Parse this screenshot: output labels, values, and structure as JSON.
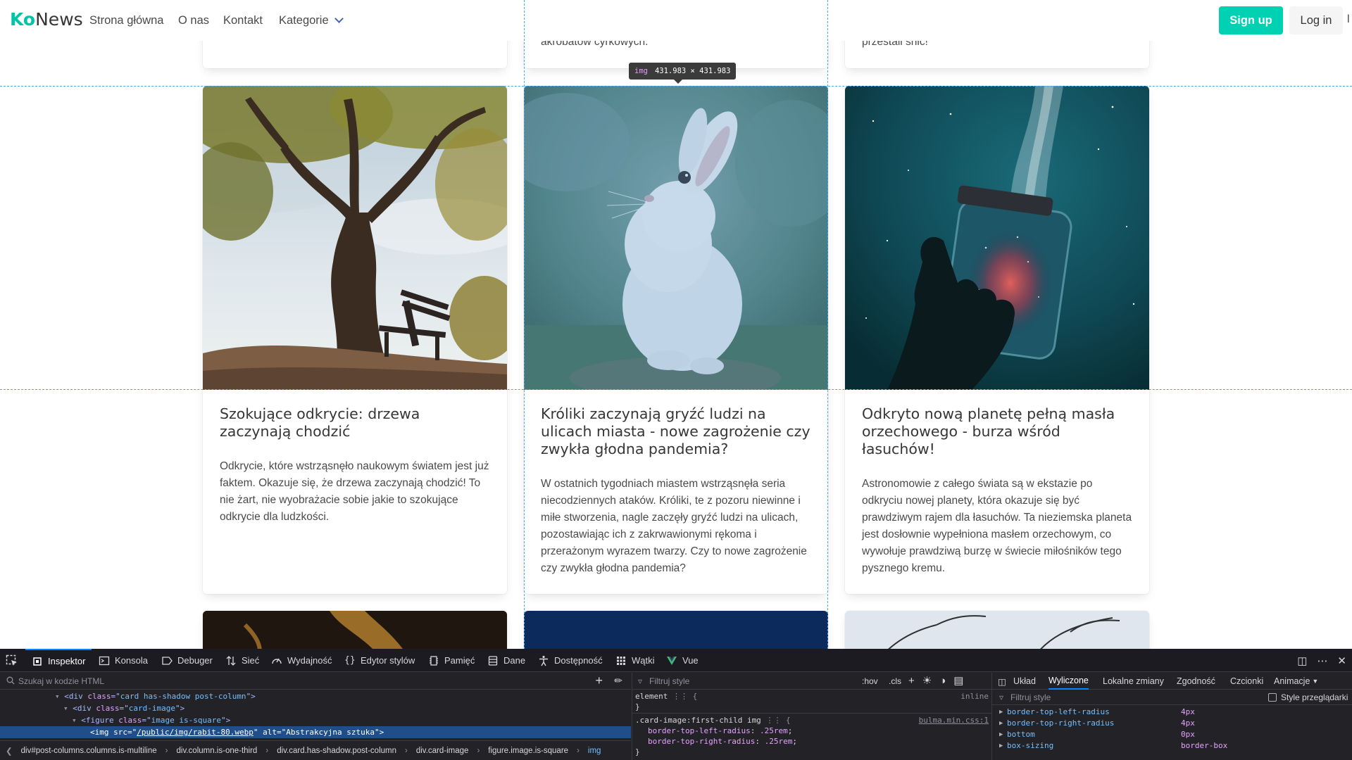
{
  "navbar": {
    "brand_ko": "Ko",
    "brand_news": "News",
    "items": [
      "Strona główna",
      "O nas",
      "Kontakt",
      "Kategorie"
    ],
    "signup": "Sign up",
    "login": "Log in",
    "edge_char": "l"
  },
  "top_row": {
    "middle_snippet": "akrobatów cyrkowych.",
    "right_snippet": "przestali śnić!"
  },
  "inspector_tooltip": {
    "tag": "img",
    "size": "431.983 × 431.983"
  },
  "posts": [
    {
      "title": "Szokujące odkrycie: drzewa zaczynają chodzić",
      "body": "Odkrycie, które wstrząsnęło naukowym światem jest już faktem. Okazuje się, że drzewa zaczynają chodzić! To nie żart, nie wyobrażacie sobie jakie to szokujące odkrycie dla ludzkości."
    },
    {
      "title": "Króliki zaczynają gryźć ludzi na ulicach miasta - nowe zagrożenie czy zwykła głodna pandemia?",
      "body": "W ostatnich tygodniach miastem wstrząsnęła seria niecodziennych ataków. Króliki, te z pozoru niewinne i miłe stworzenia, nagle zaczęły gryźć ludzi na ulicach, pozostawiając ich z zakrwawionymi rękoma i przerażonym wyrazem twarzy. Czy to nowe zagrożenie czy zwykła głodna pandemia?"
    },
    {
      "title": "Odkryto nową planetę pełną masła orzechowego - burza wśród łasuchów!",
      "body": "Astronomowie z całego świata są w ekstazie po odkryciu nowej planety, która okazuje się być prawdziwym rajem dla łasuchów. Ta nieziemska planeta jest dosłownie wypełniona masłem orzechowym, co wywołuje prawdziwą burzę w świecie miłośników tego pysznego kremu."
    }
  ],
  "devtools": {
    "tabs": [
      "Inspektor",
      "Konsola",
      "Debuger",
      "Sieć",
      "Wydajność",
      "Edytor stylów",
      "Pamięć",
      "Dane",
      "Dostępność",
      "Wątki",
      "Vue"
    ],
    "search_placeholder": "Szukaj w kodzie HTML",
    "html_lines": [
      {
        "tag": "div",
        "class": "card has-shadow post-column"
      },
      {
        "tag": "div",
        "class": "card-image"
      },
      {
        "tag": "figure",
        "class": "image is-square"
      }
    ],
    "selected_line": {
      "tag": "img",
      "src_attr": "src",
      "src": "/public/img/rabit-80.webp",
      "alt_attr": "alt",
      "alt": "Abstrakcyjna sztuka"
    },
    "breadcrumbs": [
      "div#post-columns.columns.is-multiline",
      "div.column.is-one-third",
      "div.card.has-shadow.post-column",
      "div.card-image",
      "figure.image.is-square",
      "img"
    ],
    "rules": {
      "filter_placeholder": "Filtruj style",
      "hov": ":hov",
      "cls": ".cls",
      "element_selector": "element",
      "element_source": "inline",
      "rule_selector": ".card-image:first-child img",
      "rule_source": "bulma.min.css:1",
      "declarations": [
        {
          "prop": "border-top-left-radius",
          "value": ".25rem"
        },
        {
          "prop": "border-top-right-radius",
          "value": ".25rem"
        }
      ]
    },
    "side_tabs": [
      "Układ",
      "Wyliczone",
      "Lokalne zmiany",
      "Zgodność",
      "Czcionki",
      "Animacje"
    ],
    "active_side_tab": "Wyliczone",
    "computed_filter_placeholder": "Filtruj style",
    "browser_styles_label": "Style przeglądarki",
    "computed": [
      {
        "name": "border-top-left-radius",
        "value": "4px"
      },
      {
        "name": "border-top-right-radius",
        "value": "4px"
      },
      {
        "name": "bottom",
        "value": "0px"
      },
      {
        "name": "box-sizing",
        "value": "border-box"
      }
    ]
  },
  "colors": {
    "brand_green": "#00c4a7",
    "signup_bg": "#00d1b2",
    "guide_blue": "#4aa8e6",
    "devtools_bg": "#232327",
    "selection": "#204e8a"
  }
}
